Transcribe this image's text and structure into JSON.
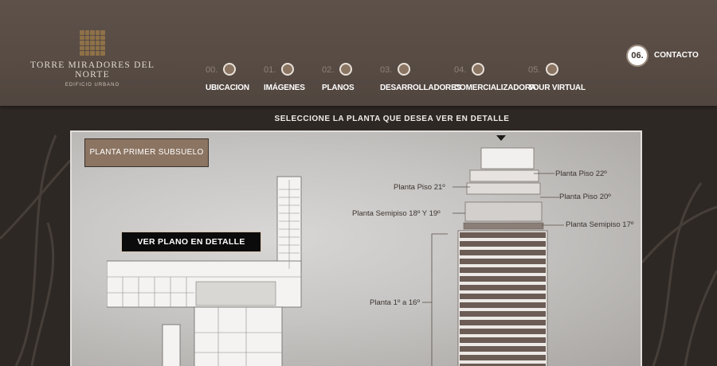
{
  "header": {
    "logo_title": "TORRE MIRADORES DEL NORTE",
    "logo_subtitle": "EDIFICIO URBANO",
    "nav": [
      {
        "num": "00.",
        "label": "UBICACION"
      },
      {
        "num": "01.",
        "label": "IMÁGENES"
      },
      {
        "num": "02.",
        "label": "PLANOS"
      },
      {
        "num": "03.",
        "label": "DESARROLLADORES"
      },
      {
        "num": "04.",
        "label": "COMERCIALIZADORA"
      },
      {
        "num": "05.",
        "label": "TOUR VIRTUAL"
      }
    ],
    "contact": {
      "num": "06.",
      "label": "CONTACTO"
    }
  },
  "main": {
    "instruction": "SELECCIONE  LA PLANTA QUE DESEA VER EN DETALLE",
    "floor_button": "PLANTA PRIMER SUBSUELO",
    "detail_button": "VER PLANO EN DETALLE",
    "tower_labels": {
      "piso22": "Planta Piso 22º",
      "piso21": "Planta Piso 21º",
      "piso20": "Planta Piso 20º",
      "semipiso18_19": "Planta Semipiso 18º Y 19º",
      "semipiso17": "Planta Semipiso 17º",
      "planta1_16": "Planta 1º a 16º"
    }
  },
  "colors": {
    "header_bg": "#574b44",
    "page_bg": "#2e2824",
    "button_brown": "#8b7462",
    "floor_band": "#6b5c55"
  }
}
